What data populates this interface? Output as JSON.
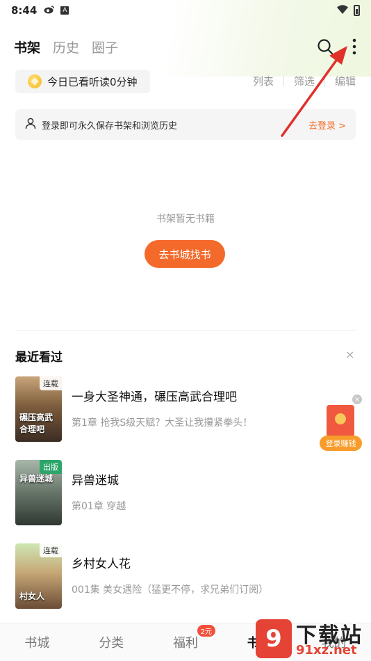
{
  "status_bar": {
    "time": "8:44"
  },
  "top_tabs": [
    {
      "label": "书架",
      "active": true
    },
    {
      "label": "历史",
      "active": false
    },
    {
      "label": "圈子",
      "active": false
    }
  ],
  "read_time": {
    "label": "今日已看听读0分钟"
  },
  "view_options": [
    "列表",
    "筛选",
    "编辑"
  ],
  "login_bar": {
    "text": "登录即可永久保存书架和浏览历史",
    "action": "去登录 >"
  },
  "shelf_empty": {
    "text": "书架暂无书籍",
    "button": "去书城找书"
  },
  "recent": {
    "title": "最近看过",
    "close": "×",
    "books": [
      {
        "title": "一身大圣神通，碾压高武合理吧",
        "chapter": "第1章 抢我S级天赋？大圣让我攥紧拳头！",
        "tag": "连载",
        "cover_text": "碾压高武 合理吧"
      },
      {
        "title": "异兽迷城",
        "chapter": "第01章 穿越",
        "tag": "出版",
        "cover_text": "异兽迷城"
      },
      {
        "title": "乡村女人花",
        "chapter": "001集 美女遇险（猛更不停，求兄弟们订阅）",
        "tag": "连载",
        "cover_text": "村女人"
      }
    ]
  },
  "promo": {
    "label": "登录赚钱",
    "close": "×"
  },
  "bottom_nav": [
    {
      "label": "书城",
      "active": false
    },
    {
      "label": "分类",
      "active": false
    },
    {
      "label": "福利",
      "active": false,
      "badge": "2元"
    },
    {
      "label": "书架",
      "active": true
    },
    {
      "label": "我的",
      "active": false
    }
  ],
  "watermark": {
    "logo": "9",
    "title": "下载站",
    "url": "91xz.net"
  },
  "colors": {
    "accent": "#f46a2a",
    "arrow": "#e0302a"
  }
}
